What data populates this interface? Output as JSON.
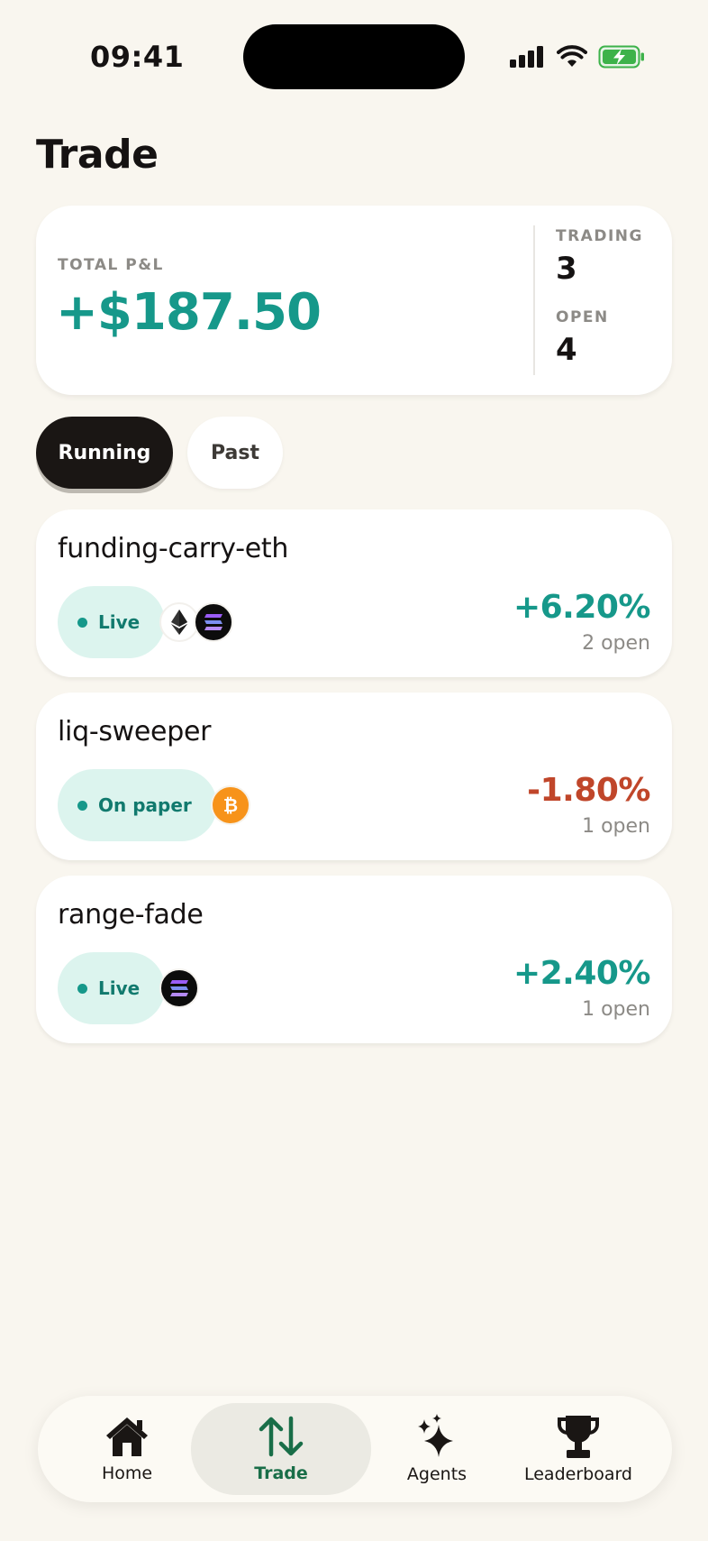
{
  "status_bar": {
    "time": "09:41",
    "icons": [
      "signal-icon",
      "wifi-icon",
      "battery-charging-icon"
    ]
  },
  "page": {
    "title": "Trade"
  },
  "summary": {
    "pnl_label": "TOTAL P&L",
    "pnl_value": "+$187.50",
    "trading_label": "TRADING",
    "trading_value": "3",
    "open_label": "OPEN",
    "open_value": "4"
  },
  "tabs": [
    {
      "label": "Running",
      "selected": true
    },
    {
      "label": "Past",
      "selected": false
    }
  ],
  "strategies": [
    {
      "name": "funding-carry-eth",
      "mode": "Live",
      "coins": [
        "eth",
        "sol"
      ],
      "change": "+6.20%",
      "direction": "up",
      "open": "2 open"
    },
    {
      "name": "liq-sweeper",
      "mode": "On paper",
      "coins": [
        "btc"
      ],
      "change": "-1.80%",
      "direction": "down",
      "open": "1 open"
    },
    {
      "name": "range-fade",
      "mode": "Live",
      "coins": [
        "sol"
      ],
      "change": "+2.40%",
      "direction": "up",
      "open": "1 open"
    }
  ],
  "nav": [
    {
      "label": "Home",
      "icon": "home-icon",
      "active": false
    },
    {
      "label": "Trade",
      "icon": "trade-arrows-icon",
      "active": true
    },
    {
      "label": "Agents",
      "icon": "sparkles-icon",
      "active": false
    },
    {
      "label": "Leaderboard",
      "icon": "trophy-icon",
      "active": false
    }
  ],
  "colors": {
    "background": "#f9f6ef",
    "positive": "#16988a",
    "negative": "#c0462a",
    "badge_bg": "#dcf4ee",
    "nav_active": "#196e48"
  }
}
